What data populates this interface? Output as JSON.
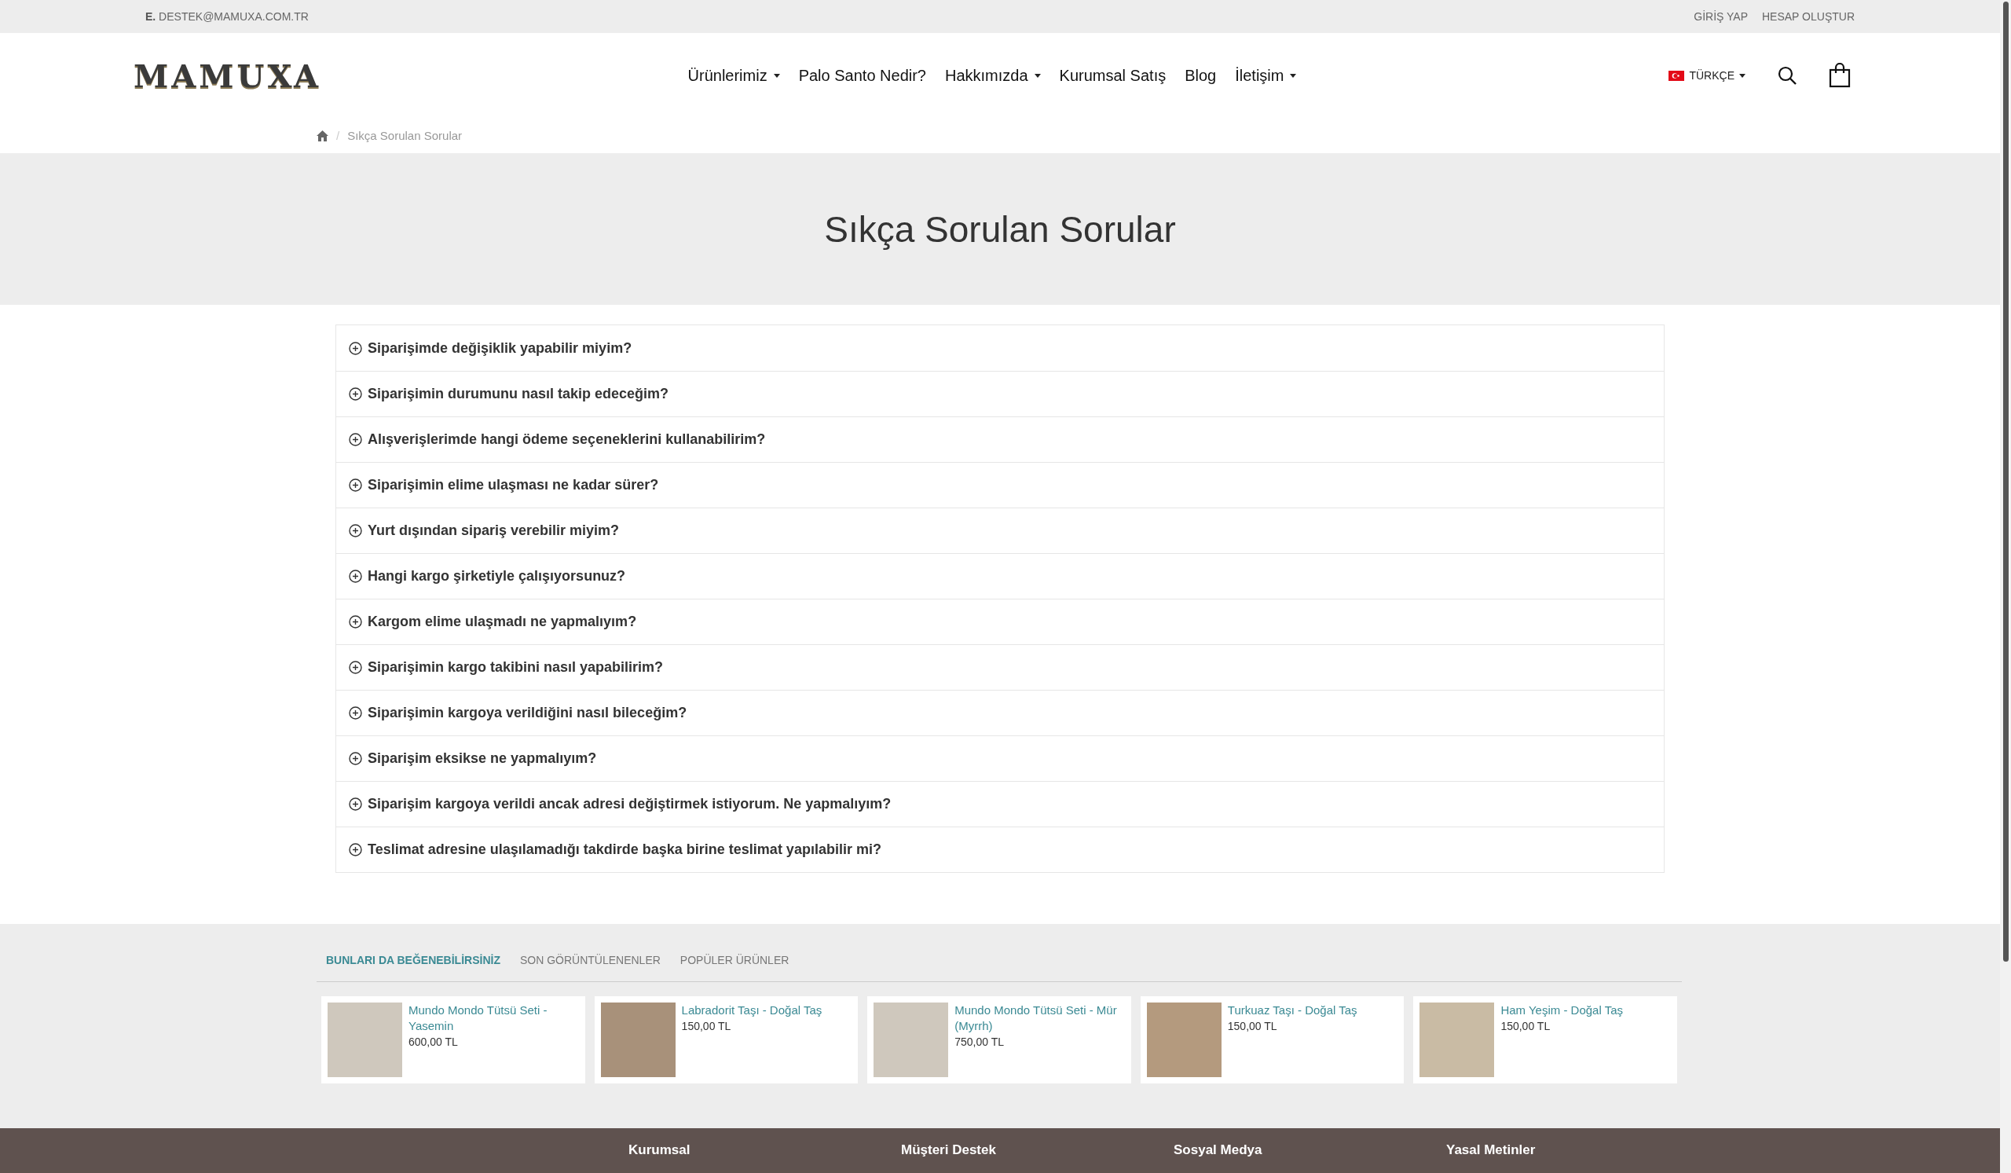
{
  "top_bar": {
    "email_label": "E.",
    "email": "DESTEK@MAMUXA.COM.TR",
    "links": [
      "GİRİŞ YAP",
      "HESAP OLUŞTUR"
    ]
  },
  "header": {
    "logo": "MAMUXA",
    "nav": [
      {
        "label": "Ürünlerimiz",
        "dropdown": true
      },
      {
        "label": "Palo Santo Nedir?",
        "dropdown": false
      },
      {
        "label": "Hakkımızda",
        "dropdown": true
      },
      {
        "label": "Kurumsal Satış",
        "dropdown": false
      },
      {
        "label": "Blog",
        "dropdown": false
      },
      {
        "label": "İletişim",
        "dropdown": true
      }
    ],
    "language": "TÜRKÇE"
  },
  "breadcrumb": {
    "separator": "/",
    "current": "Sıkça Sorulan Sorular"
  },
  "page_title": "Sıkça Sorulan Sorular",
  "faq": [
    {
      "question": "Siparişimde değişiklik yapabilir miyim?",
      "expanded": false
    },
    {
      "question": "Siparişimin durumunu nasıl takip edeceğim?",
      "expanded": false
    },
    {
      "question": "Alışverişlerimde hangi ödeme seçeneklerini kullanabilirim?",
      "expanded": false
    },
    {
      "question": "Siparişimin elime ulaşması ne kadar sürer?",
      "expanded": false
    },
    {
      "question": "Yurt dışından sipariş verebilir miyim?",
      "expanded": false
    },
    {
      "question": "Hangi kargo şirketiyle çalışıyorsunuz?",
      "expanded": false
    },
    {
      "question": "Kargom elime ulaşmadı ne yapmalıyım?",
      "expanded": false
    },
    {
      "question": "Siparişimin kargo takibini nasıl yapabilirim?",
      "expanded": false
    },
    {
      "question": "Siparişimin kargoya verildiğini nasıl bileceğim?",
      "expanded": false
    },
    {
      "question": "Siparişim eksikse ne yapmalıyım?",
      "expanded": false
    },
    {
      "question": "Siparişim kargoya verildi ancak adresi değiştirmek istiyorum. Ne yapmalıyım?",
      "expanded": false
    },
    {
      "question": "Teslimat adresine ulaşılamadığı takdirde başka birine teslimat yapılabilir mi?",
      "expanded": false
    }
  ],
  "product_tabs": [
    {
      "label": "BUNLARI DA BEĞENEBİLİRSİNİZ",
      "selected": true
    },
    {
      "label": "SON GÖRÜNTÜLENENLER",
      "selected": false
    },
    {
      "label": "POPÜLER ÜRÜNLER",
      "selected": false
    }
  ],
  "products": [
    {
      "name": "Mundo Mondo Tütsü Seti - Yasemin",
      "price": "600,00 TL"
    },
    {
      "name": "Labradorit Taşı - Doğal Taş",
      "price": "150,00 TL"
    },
    {
      "name": "Mundo Mondo Tütsü Seti - Mür (Myrrh)",
      "price": "750,00 TL"
    },
    {
      "name": "Turkuaz Taşı - Doğal Taş",
      "price": "150,00 TL"
    },
    {
      "name": "Ham Yeşim - Doğal Taş",
      "price": "150,00 TL"
    }
  ],
  "footer": {
    "headings": [
      "Kurumsal",
      "Müşteri Destek",
      "Sosyal Medya",
      "Yasal Metinler"
    ]
  }
}
